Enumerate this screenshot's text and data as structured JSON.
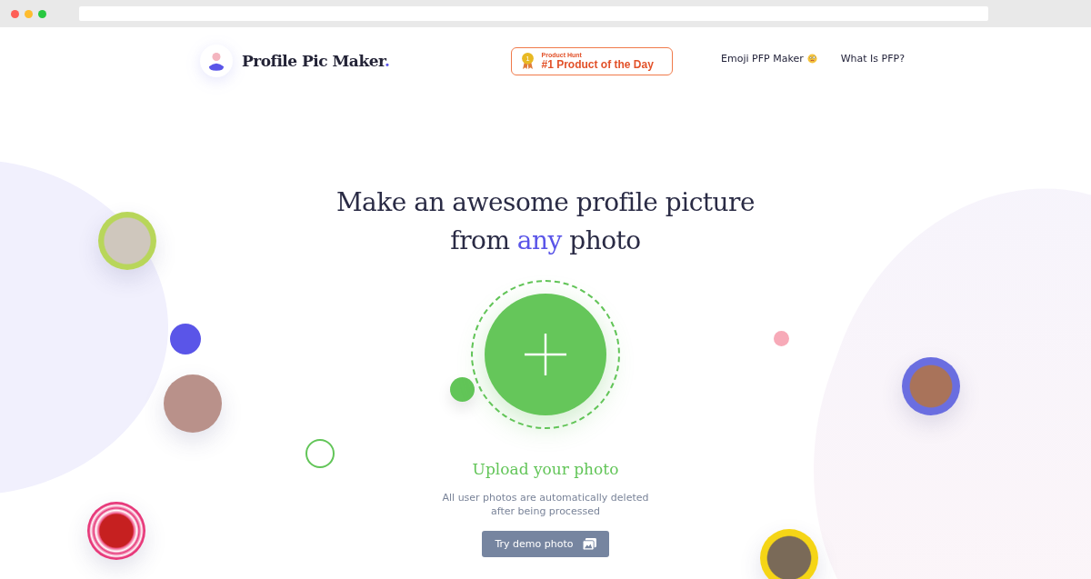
{
  "header": {
    "logo": {
      "name": "Profile Pic Maker",
      "dot": "."
    },
    "badge": {
      "caption": "Product Hunt",
      "title": "#1 Product of the Day",
      "rank": "1"
    },
    "nav": [
      {
        "label": "Emoji PFP Maker",
        "kind": "emoji"
      },
      {
        "label": "What Is PFP?",
        "kind": "plain"
      }
    ]
  },
  "hero": {
    "headline": {
      "before": "Make an awesome profile picture",
      "middle": "from",
      "highlight": "any",
      "after": "photo"
    },
    "upload_label": "Upload your photo",
    "note": "All user photos are automatically deleted after being processed",
    "demo_button": "Try demo photo"
  }
}
